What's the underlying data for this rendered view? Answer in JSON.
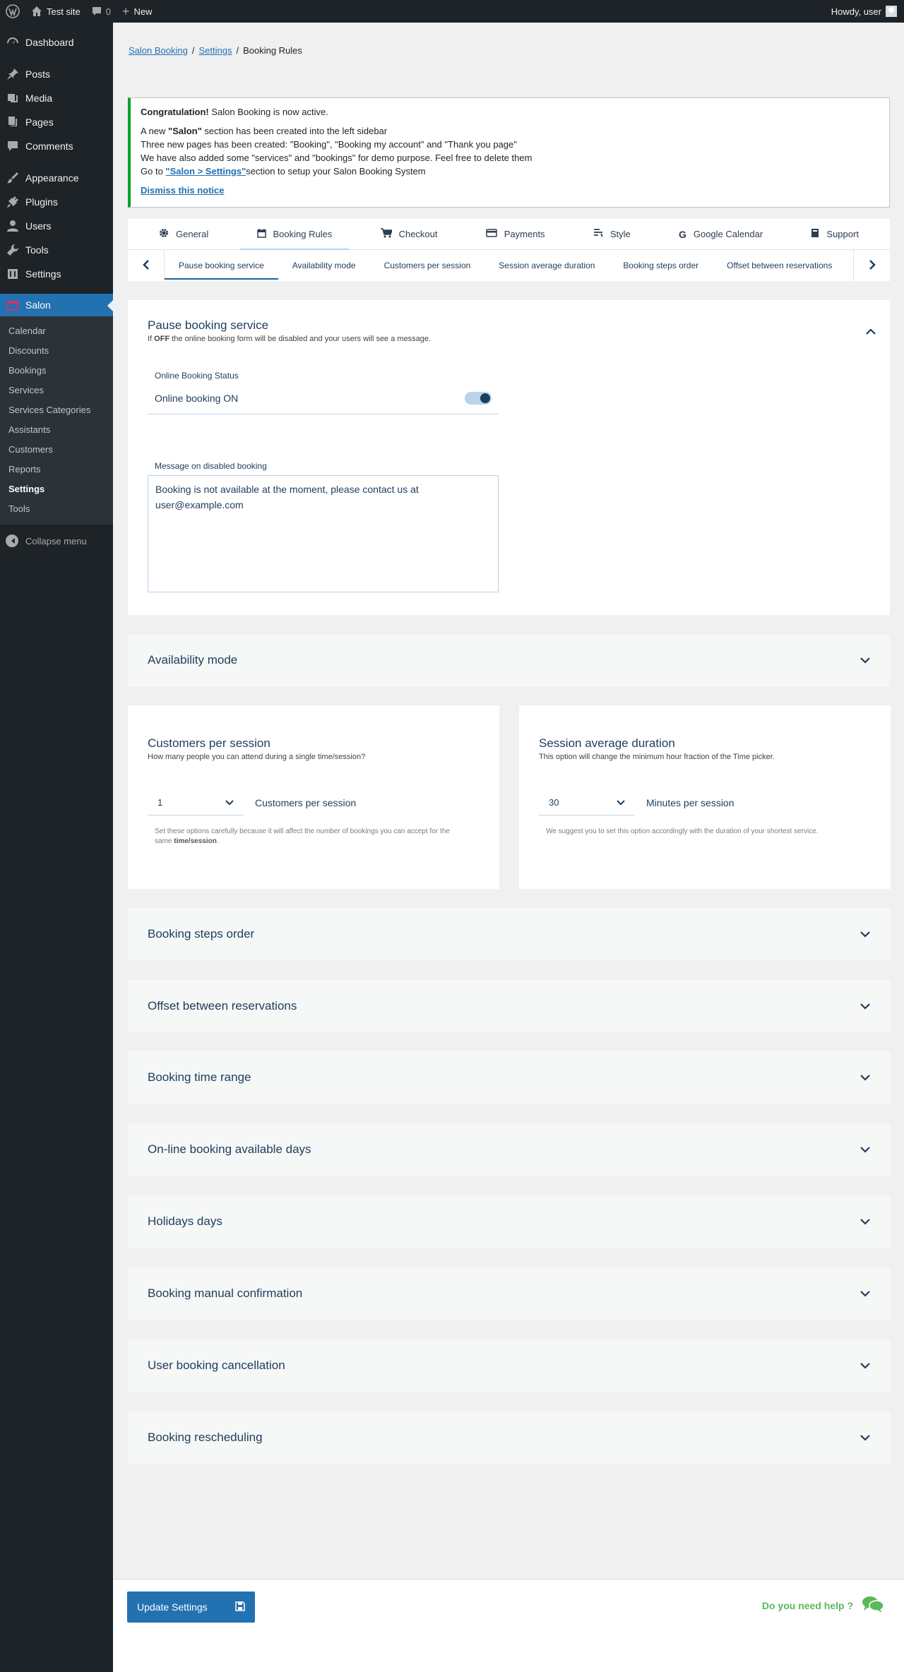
{
  "adminbar": {
    "site_name": "Test site",
    "comments_count": "0",
    "new_label": "New",
    "howdy": "Howdy, user"
  },
  "sidebar": {
    "items": [
      {
        "label": "Dashboard",
        "icon": "dashboard-icon"
      },
      {
        "label": "Posts",
        "icon": "pin-icon"
      },
      {
        "label": "Media",
        "icon": "media-icon"
      },
      {
        "label": "Pages",
        "icon": "pages-icon"
      },
      {
        "label": "Comments",
        "icon": "comment-icon"
      },
      {
        "label": "Appearance",
        "icon": "brush-icon"
      },
      {
        "label": "Plugins",
        "icon": "plug-icon"
      },
      {
        "label": "Users",
        "icon": "user-icon"
      },
      {
        "label": "Tools",
        "icon": "wrench-icon"
      },
      {
        "label": "Settings",
        "icon": "settings-icon"
      }
    ],
    "salon_label": "Salon",
    "submenu": [
      "Calendar",
      "Discounts",
      "Bookings",
      "Services",
      "Services Categories",
      "Assistants",
      "Customers",
      "Reports",
      "Settings",
      "Tools"
    ],
    "collapse_label": "Collapse menu"
  },
  "breadcrumb": {
    "crumb1": "Salon Booking",
    "crumb2": "Settings",
    "current": "Booking Rules",
    "sep": "/"
  },
  "notice": {
    "title_bold": "Congratulation!",
    "title_rest": " Salon Booking is now active.",
    "line1_a": "A new ",
    "line1_b": "\"Salon\"",
    "line1_c": " section has been created into the left sidebar",
    "line2": "Three new pages has been created: \"Booking\", \"Booking my account\" and \"Thank you page\"",
    "line3": "We have also added some \"services\" and \"bookings\" for demo purpose. Feel free to delete them",
    "line4_a": "Go to ",
    "line4_link": "\"Salon > Settings\"",
    "line4_c": "section to setup your Salon Booking System",
    "dismiss": "Dismiss this notice"
  },
  "tabs": [
    "General",
    "Booking Rules",
    "Checkout",
    "Payments",
    "Style",
    "Google Calendar",
    "Support"
  ],
  "subtabs": [
    "Pause booking service",
    "Availability mode",
    "Customers per session",
    "Session average duration",
    "Booking steps order",
    "Offset between reservations"
  ],
  "pause": {
    "title": "Pause booking service",
    "desc_a": "If ",
    "desc_b": "OFF",
    "desc_c": " the online booking form will be disabled and your users will see a message.",
    "status_label": "Online Booking Status",
    "toggle_label": "Online booking ON",
    "toggle_on": true,
    "msg_label": "Message on disabled booking",
    "msg_value": "Booking is not available at the moment, please contact us at user@example.com"
  },
  "availability": {
    "title": "Availability mode"
  },
  "customers": {
    "title": "Customers per session",
    "desc": "How many people you can attend during a single time/session?",
    "value": "1",
    "after": "Customers per session",
    "hint_a": "Set these options carefully because it will affect the number of bookings you can accept for the same ",
    "hint_b": "time/session",
    "hint_c": "."
  },
  "duration": {
    "title": "Session average duration",
    "desc": "This option will change the minimum hour fraction of the Time picker.",
    "value": "30",
    "after": "Minutes per session",
    "hint": "We suggest you to set this option accordingly with the duration of your shortest service."
  },
  "collapsed_panels": [
    "Booking steps order",
    "Offset between reservations",
    "Booking time range",
    "On-line booking available days",
    "Holidays days",
    "Booking manual confirmation",
    "User booking cancellation",
    "Booking rescheduling"
  ],
  "footer": {
    "update_label": "Update Settings",
    "help_label": "Do you need help ?"
  },
  "colors": {
    "accent": "#2271b1",
    "notice_success": "#00a32a",
    "help": "#5cb85c",
    "heading": "#1d3d5c"
  }
}
